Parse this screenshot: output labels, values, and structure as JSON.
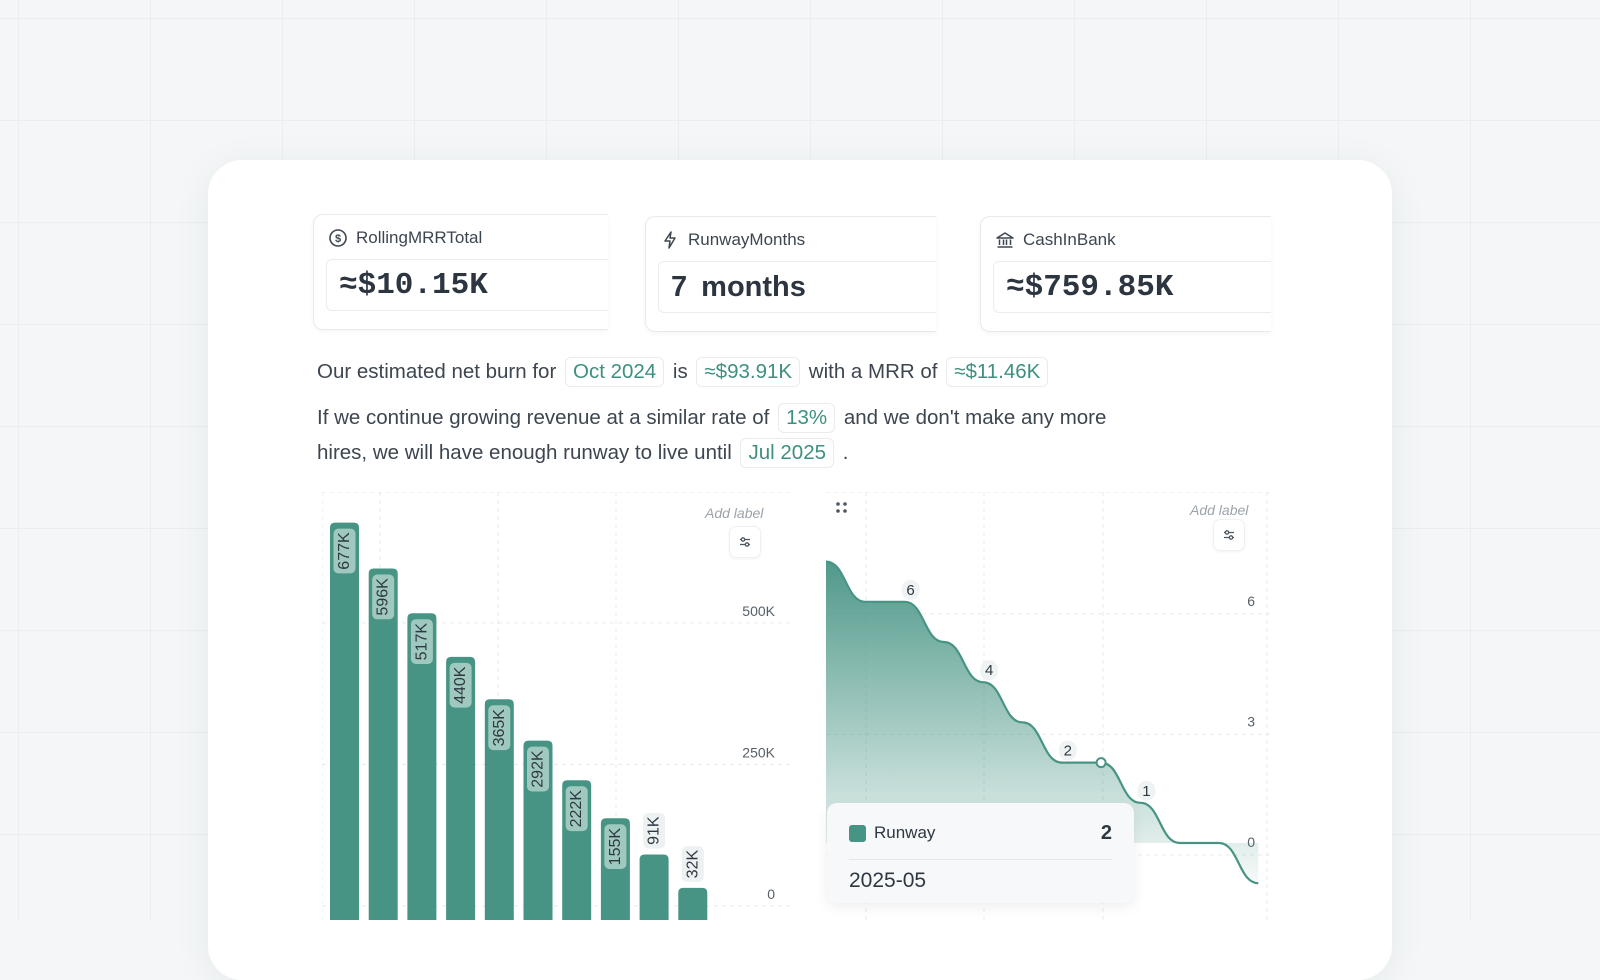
{
  "metrics": [
    {
      "label": "RollingMRRTotal",
      "value": "≈$10.15K",
      "icon": "dollar-circle-icon"
    },
    {
      "label": "RunwayMonths",
      "value": "7  months",
      "icon": "lightning-icon"
    },
    {
      "label": "CashInBank",
      "value": "≈$759.85K",
      "icon": "bank-icon"
    }
  ],
  "summary": {
    "line1": {
      "a": "Our estimated net burn for",
      "month": "Oct 2024",
      "b": "is",
      "burn": "≈$93.91K",
      "c": "with a MRR of",
      "mrr": "≈$11.46K"
    },
    "line2": {
      "a": "If we continue growing revenue at a similar rate of",
      "rate": "13%",
      "b": "and we don't make any more"
    },
    "line3": {
      "a": "hires, we will have enough runway to live until",
      "until": "Jul 2025",
      "b": "."
    }
  },
  "colors": {
    "accent": "#479484",
    "tag_text": "#3d9080"
  },
  "chart_data": [
    {
      "type": "bar",
      "add_label": "Add label",
      "values": [
        677,
        596,
        517,
        440,
        365,
        292,
        222,
        155,
        91,
        32
      ],
      "value_labels": [
        "677K",
        "596K",
        "517K",
        "440K",
        "365K",
        "292K",
        "222K",
        "155K",
        "91K",
        "32K"
      ],
      "y_ticks": [
        "500K",
        "250K",
        "0"
      ],
      "y_tick_values": [
        500,
        250,
        0
      ],
      "ylim": [
        0,
        700
      ],
      "grid": true
    },
    {
      "type": "area",
      "add_label": "Add label",
      "y_ticks": [
        "6",
        "3",
        "0"
      ],
      "y_tick_values": [
        6,
        3,
        0
      ],
      "points": [
        {
          "i": 0,
          "y": 7
        },
        {
          "i": 1,
          "y": 6
        },
        {
          "i": 2,
          "y": 6
        },
        {
          "i": 3,
          "y": 5
        },
        {
          "i": 4,
          "y": 4
        },
        {
          "i": 5,
          "y": 3
        },
        {
          "i": 6,
          "y": 2
        },
        {
          "i": 7,
          "y": 2
        },
        {
          "i": 8,
          "y": 1
        },
        {
          "i": 9,
          "y": 0
        },
        {
          "i": 10,
          "y": 0
        },
        {
          "i": 11,
          "y": -1
        }
      ],
      "point_labels": [
        {
          "i": 2,
          "text": "6"
        },
        {
          "i": 4,
          "text": "4"
        },
        {
          "i": 6,
          "text": "2"
        },
        {
          "i": 8,
          "text": "1"
        }
      ],
      "ylim": [
        -1,
        7.5
      ],
      "tooltip": {
        "series": "Runway",
        "value": "2",
        "date": "2025-05"
      }
    }
  ]
}
